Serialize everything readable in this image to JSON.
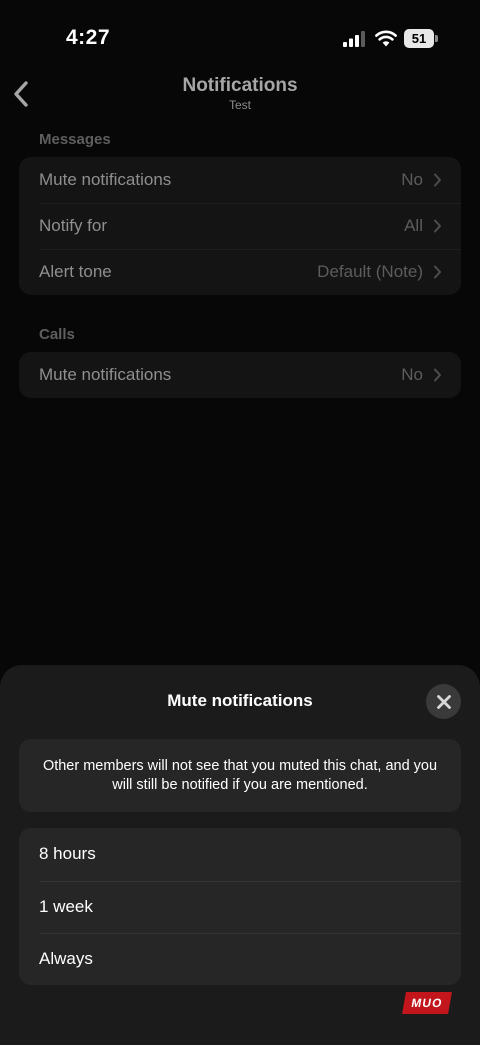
{
  "status_bar": {
    "time": "4:27",
    "battery": "51"
  },
  "nav": {
    "title": "Notifications",
    "subtitle": "Test"
  },
  "messages_section": {
    "header": "Messages",
    "rows": [
      {
        "label": "Mute notifications",
        "value": "No"
      },
      {
        "label": "Notify for",
        "value": "All"
      },
      {
        "label": "Alert tone",
        "value": "Default (Note)"
      }
    ]
  },
  "calls_section": {
    "header": "Calls",
    "rows": [
      {
        "label": "Mute notifications",
        "value": "No"
      }
    ]
  },
  "sheet": {
    "title": "Mute notifications",
    "info": "Other members will not see that you muted this chat, and you will still be notified if you are mentioned.",
    "options": [
      "8 hours",
      "1 week",
      "Always"
    ]
  },
  "watermark": "MUO",
  "colors": {
    "background": "#070707",
    "sheet": "#1b1b1b",
    "card": "#262626",
    "close_button": "#3a3a3a",
    "watermark": "#c2161c"
  },
  "icons": [
    "signal-icon",
    "wifi-icon",
    "battery-icon",
    "back-chevron-icon",
    "chevron-right-icon",
    "close-icon"
  ]
}
